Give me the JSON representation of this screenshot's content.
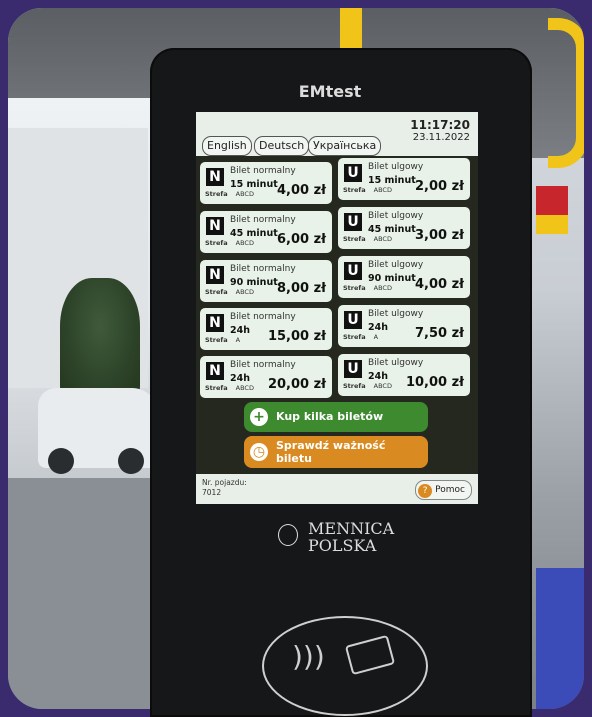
{
  "device": {
    "brand": "EMtest",
    "maker_logo": [
      "MENNICA",
      "POLSKA"
    ]
  },
  "screen": {
    "languages": [
      "English",
      "Deutsch",
      "Українська"
    ],
    "time": "11:17:20",
    "date": "23.11.2022",
    "tickets": [
      {
        "badge": "N",
        "name": "Bilet normalny",
        "duration": "15 minut",
        "zone_label": "Strefa",
        "zone": "ABCD",
        "price": "4,00 zł"
      },
      {
        "badge": "U",
        "name": "Bilet ulgowy",
        "duration": "15 minut",
        "zone_label": "Strefa",
        "zone": "ABCD",
        "price": "2,00 zł"
      },
      {
        "badge": "N",
        "name": "Bilet normalny",
        "duration": "45 minut",
        "zone_label": "Strefa",
        "zone": "ABCD",
        "price": "6,00 zł"
      },
      {
        "badge": "U",
        "name": "Bilet ulgowy",
        "duration": "45 minut",
        "zone_label": "Strefa",
        "zone": "ABCD",
        "price": "3,00 zł"
      },
      {
        "badge": "N",
        "name": "Bilet normalny",
        "duration": "90 minut",
        "zone_label": "Strefa",
        "zone": "ABCD",
        "price": "8,00 zł"
      },
      {
        "badge": "U",
        "name": "Bilet ulgowy",
        "duration": "90 minut",
        "zone_label": "Strefa",
        "zone": "ABCD",
        "price": "4,00 zł"
      },
      {
        "badge": "N",
        "name": "Bilet normalny",
        "duration": "24h",
        "zone_label": "Strefa",
        "zone": "A",
        "price": "15,00 zł"
      },
      {
        "badge": "U",
        "name": "Bilet ulgowy",
        "duration": "24h",
        "zone_label": "Strefa",
        "zone": "A",
        "price": "7,50 zł"
      },
      {
        "badge": "N",
        "name": "Bilet normalny",
        "duration": "24h",
        "zone_label": "Strefa",
        "zone": "ABCD",
        "price": "20,00 zł"
      },
      {
        "badge": "U",
        "name": "Bilet ulgowy",
        "duration": "24h",
        "zone_label": "Strefa",
        "zone": "ABCD",
        "price": "10,00 zł"
      }
    ],
    "buy_multiple_label": "Kup kilka biletów",
    "check_validity_label": "Sprawdź ważność biletu",
    "vehicle_label": "Nr. pojazdu:",
    "vehicle_number": "7012",
    "help_label": "Pomoc"
  },
  "colors": {
    "buy_button": "#3d8a2f",
    "check_button": "#d98a21",
    "tile_background": "#e8f2e8"
  }
}
